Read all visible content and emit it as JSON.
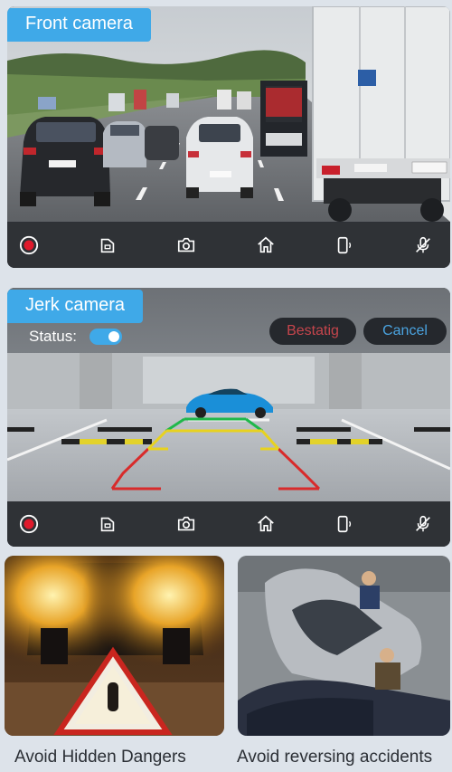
{
  "front_camera": {
    "label": "Front camera",
    "truck_plate_text": "SCHMITZ",
    "car_plate_text": "RL 3432"
  },
  "rear_camera": {
    "label": "Jerk camera",
    "status_label": "Status:",
    "status_on": true,
    "confirm_label": "Bestatig",
    "cancel_label": "Cancel"
  },
  "toolbar_icons": [
    "record-icon",
    "sd-card-icon",
    "camera-icon",
    "home-icon",
    "phone-icon",
    "mic-off-icon"
  ],
  "features": {
    "left_caption": "Avoid Hidden Dangers",
    "right_caption": "Avoid reversing accidents"
  },
  "colors": {
    "accent": "#3fa9e8",
    "record": "#e0192b",
    "confirm_text": "#c5454c",
    "cancel_text": "#4aa3e0"
  }
}
